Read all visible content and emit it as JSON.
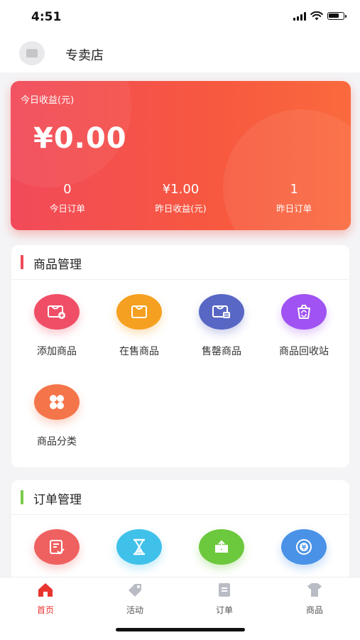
{
  "status_bar": {
    "time": "4:51"
  },
  "header": {
    "store_name": "专卖店"
  },
  "earnings": {
    "title": "今日收益(元)",
    "amount": "¥0.00",
    "stats": [
      {
        "value": "0",
        "label": "今日订单"
      },
      {
        "value": "¥1.00",
        "label": "昨日收益(元)"
      },
      {
        "value": "1",
        "label": "昨日订单"
      }
    ]
  },
  "product_mgmt": {
    "title": "商品管理",
    "accent_color": "#f24a5a",
    "items": [
      {
        "label": "添加商品",
        "icon": "add-product-icon",
        "color": "#f04e66"
      },
      {
        "label": "在售商品",
        "icon": "on-sale-icon",
        "color": "#f5a020"
      },
      {
        "label": "售罄商品",
        "icon": "sold-out-icon",
        "color": "#5867c4"
      },
      {
        "label": "商品回收站",
        "icon": "recycle-bin-icon",
        "color": "#a052f2"
      },
      {
        "label": "商品分类",
        "icon": "category-icon",
        "color": "#f4754a"
      }
    ]
  },
  "order_mgmt": {
    "title": "订单管理",
    "accent_color": "#7ccb4a",
    "items": [
      {
        "icon": "order-edit-icon",
        "color": "#ee6160"
      },
      {
        "icon": "hourglass-icon",
        "color": "#3fc1ea"
      },
      {
        "icon": "shipping-icon",
        "color": "#6cc83c"
      },
      {
        "icon": "refund-icon",
        "color": "#4a92e8"
      }
    ]
  },
  "tabbar": {
    "items": [
      {
        "label": "首页",
        "icon": "home-icon",
        "active": true
      },
      {
        "label": "活动",
        "icon": "tag-icon",
        "active": false
      },
      {
        "label": "订单",
        "icon": "order-icon",
        "active": false
      },
      {
        "label": "商品",
        "icon": "product-icon",
        "active": false
      }
    ]
  }
}
